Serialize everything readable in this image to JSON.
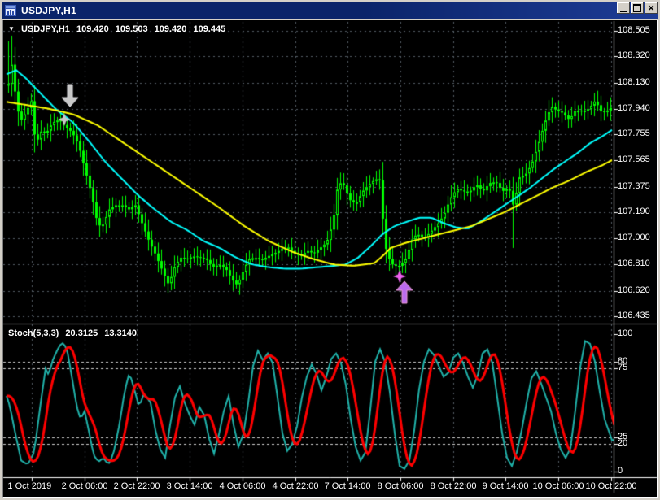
{
  "window": {
    "title": "USDJPY,H1",
    "buttons": {
      "minimize": "minimize",
      "maximize": "maximize",
      "close_glyph": "×"
    }
  },
  "header": {
    "dropdown_glyph": "▼",
    "symbol": "USDJPY,H1",
    "open": "109.420",
    "high": "109.503",
    "low": "109.420",
    "close": "109.445"
  },
  "indicator": {
    "name": "Stoch(5,3,3)",
    "main_value": "20.3125",
    "signal_value": "13.3140"
  },
  "price_axis_labels": [
    "108.505",
    "108.320",
    "108.130",
    "107.940",
    "107.755",
    "107.565",
    "107.375",
    "107.190",
    "107.000",
    "106.810",
    "106.620",
    "106.435"
  ],
  "stoch_axis_labels": [
    "100",
    "80",
    "75",
    "25",
    "20",
    "0"
  ],
  "time_axis_labels": [
    "1 Oct 2019",
    "2 Oct 06:00",
    "2 Oct 22:00",
    "3 Oct 14:00",
    "4 Oct 06:00",
    "4 Oct 22:00",
    "7 Oct 14:00",
    "8 Oct 06:00",
    "8 Oct 22:00",
    "9 Oct 14:00",
    "10 Oct 06:00",
    "10 Oct 22:00"
  ],
  "colors": {
    "background": "#000000",
    "titlebar": "#0A246A",
    "frame": "#D4D0C8",
    "grid": "#555E66",
    "level_line": "#CFCFCF",
    "axis_text": "#FFFFFF",
    "scale_line": "#FFFFFF",
    "separator": "#9A9A9A",
    "candle": "#00FF00",
    "ma_fast_cyan": "#00FFFF",
    "ma_slow_yellow": "#FFFF00",
    "stoch_main": "#20B2AA",
    "stoch_signal": "#FF0000",
    "marker_silver": "#C8C8C8",
    "marker_violet_star": "#ED5FED",
    "marker_violet_arrow": "#BB6BEE"
  },
  "chart_data": {
    "type": "candlestick",
    "symbol": "USDJPY",
    "timeframe": "H1",
    "price_pane": {
      "ylim": [
        106.405,
        108.552
      ],
      "grid_prices": [
        108.505,
        108.32,
        108.13,
        107.94,
        107.755,
        107.565,
        107.375,
        107.19,
        107.0,
        106.81,
        106.62,
        106.435
      ],
      "close_path": [
        [
          10,
          108.12
        ],
        [
          13,
          108.3
        ],
        [
          16,
          108.18
        ],
        [
          20,
          107.95
        ],
        [
          26,
          107.86
        ],
        [
          32,
          107.92
        ],
        [
          40,
          108.02
        ],
        [
          43,
          107.62
        ],
        [
          48,
          107.78
        ],
        [
          56,
          107.76
        ],
        [
          64,
          107.84
        ],
        [
          72,
          107.86
        ],
        [
          80,
          107.81
        ],
        [
          88,
          107.77
        ],
        [
          96,
          107.68
        ],
        [
          104,
          107.5
        ],
        [
          112,
          107.32
        ],
        [
          120,
          107.09
        ],
        [
          126,
          107.1
        ],
        [
          134,
          107.21
        ],
        [
          142,
          107.24
        ],
        [
          150,
          107.24
        ],
        [
          158,
          107.21
        ],
        [
          166,
          107.24
        ],
        [
          174,
          107.11
        ],
        [
          182,
          106.99
        ],
        [
          190,
          106.89
        ],
        [
          198,
          106.78
        ],
        [
          207,
          106.66
        ],
        [
          213,
          106.78
        ],
        [
          221,
          106.86
        ],
        [
          229,
          106.85
        ],
        [
          237,
          106.87
        ],
        [
          245,
          106.86
        ],
        [
          253,
          106.85
        ],
        [
          261,
          106.79
        ],
        [
          269,
          106.81
        ],
        [
          277,
          106.78
        ],
        [
          285,
          106.7
        ],
        [
          291,
          106.66
        ],
        [
          297,
          106.74
        ],
        [
          305,
          106.85
        ],
        [
          313,
          106.86
        ],
        [
          321,
          106.84
        ],
        [
          329,
          106.87
        ],
        [
          337,
          106.89
        ],
        [
          345,
          106.92
        ],
        [
          353,
          106.94
        ],
        [
          361,
          106.89
        ],
        [
          369,
          106.87
        ],
        [
          377,
          106.91
        ],
        [
          385,
          106.89
        ],
        [
          393,
          106.93
        ],
        [
          401,
          106.97
        ],
        [
          409,
          107.12
        ],
        [
          415,
          107.4
        ],
        [
          421,
          107.4
        ],
        [
          429,
          107.28
        ],
        [
          437,
          107.25
        ],
        [
          445,
          107.34
        ],
        [
          453,
          107.39
        ],
        [
          461,
          107.43
        ],
        [
          467,
          107.42
        ],
        [
          471,
          107.05
        ],
        [
          475,
          106.88
        ],
        [
          483,
          106.8
        ],
        [
          491,
          106.8
        ],
        [
          499,
          106.86
        ],
        [
          507,
          107.01
        ],
        [
          513,
          107.03
        ],
        [
          521,
          107.0
        ],
        [
          529,
          107.05
        ],
        [
          537,
          107.1
        ],
        [
          545,
          107.17
        ],
        [
          553,
          107.29
        ],
        [
          561,
          107.36
        ],
        [
          569,
          107.34
        ],
        [
          577,
          107.34
        ],
        [
          585,
          107.39
        ],
        [
          593,
          107.34
        ],
        [
          601,
          107.4
        ],
        [
          609,
          107.41
        ],
        [
          617,
          107.34
        ],
        [
          625,
          107.37
        ],
        [
          631,
          107.22
        ],
        [
          637,
          107.44
        ],
        [
          645,
          107.46
        ],
        [
          653,
          107.54
        ],
        [
          661,
          107.68
        ],
        [
          669,
          107.84
        ],
        [
          677,
          107.96
        ],
        [
          683,
          107.93
        ],
        [
          691,
          107.91
        ],
        [
          699,
          107.86
        ],
        [
          707,
          107.93
        ],
        [
          715,
          107.92
        ],
        [
          723,
          107.94
        ],
        [
          731,
          108.0
        ],
        [
          739,
          107.91
        ],
        [
          747,
          107.93
        ],
        [
          752,
          107.96
        ]
      ],
      "wick_spikes": {
        "high": [
          [
            9,
            108.43
          ],
          [
            13,
            108.47
          ]
        ],
        "low": [
          [
            207,
            106.64
          ],
          [
            291,
            106.65
          ],
          [
            363,
            106.84
          ],
          [
            631,
            106.93
          ]
        ]
      },
      "ma_cyan": [
        [
          8,
          108.19
        ],
        [
          20,
          108.22
        ],
        [
          32,
          108.16
        ],
        [
          50,
          108.05
        ],
        [
          70,
          107.93
        ],
        [
          90,
          107.84
        ],
        [
          110,
          107.7
        ],
        [
          130,
          107.55
        ],
        [
          150,
          107.43
        ],
        [
          170,
          107.31
        ],
        [
          190,
          107.21
        ],
        [
          210,
          107.12
        ],
        [
          230,
          107.06
        ],
        [
          250,
          106.98
        ],
        [
          270,
          106.93
        ],
        [
          290,
          106.86
        ],
        [
          310,
          106.81
        ],
        [
          330,
          106.79
        ],
        [
          350,
          106.78
        ],
        [
          370,
          106.78
        ],
        [
          390,
          106.79
        ],
        [
          410,
          106.8
        ],
        [
          425,
          106.81
        ],
        [
          440,
          106.86
        ],
        [
          455,
          106.94
        ],
        [
          470,
          107.03
        ],
        [
          485,
          107.09
        ],
        [
          500,
          107.12
        ],
        [
          515,
          107.15
        ],
        [
          530,
          107.15
        ],
        [
          545,
          107.11
        ],
        [
          560,
          107.08
        ],
        [
          575,
          107.07
        ],
        [
          590,
          107.12
        ],
        [
          605,
          107.18
        ],
        [
          620,
          107.24
        ],
        [
          635,
          107.3
        ],
        [
          650,
          107.36
        ],
        [
          665,
          107.43
        ],
        [
          680,
          107.5
        ],
        [
          695,
          107.56
        ],
        [
          710,
          107.62
        ],
        [
          725,
          107.69
        ],
        [
          740,
          107.74
        ],
        [
          753,
          107.79
        ]
      ],
      "ma_yellow": [
        [
          8,
          107.99
        ],
        [
          30,
          107.97
        ],
        [
          60,
          107.94
        ],
        [
          90,
          107.9
        ],
        [
          120,
          107.82
        ],
        [
          150,
          107.7
        ],
        [
          180,
          107.58
        ],
        [
          210,
          107.46
        ],
        [
          240,
          107.34
        ],
        [
          270,
          107.22
        ],
        [
          300,
          107.09
        ],
        [
          330,
          106.98
        ],
        [
          360,
          106.9
        ],
        [
          385,
          106.85
        ],
        [
          410,
          106.81
        ],
        [
          435,
          106.8
        ],
        [
          460,
          106.82
        ],
        [
          470,
          106.87
        ],
        [
          480,
          106.93
        ],
        [
          500,
          106.97
        ],
        [
          520,
          107.0
        ],
        [
          540,
          107.03
        ],
        [
          560,
          107.06
        ],
        [
          580,
          107.09
        ],
        [
          600,
          107.14
        ],
        [
          620,
          107.19
        ],
        [
          640,
          107.25
        ],
        [
          660,
          107.31
        ],
        [
          680,
          107.37
        ],
        [
          700,
          107.42
        ],
        [
          720,
          107.48
        ],
        [
          740,
          107.53
        ],
        [
          753,
          107.57
        ]
      ],
      "markers": [
        {
          "shape": "arrow-down",
          "x": 86,
          "price": 107.956,
          "color": "silver"
        },
        {
          "shape": "star4",
          "x": 79,
          "price": 107.862,
          "color": "silver"
        },
        {
          "shape": "star4",
          "x": 491,
          "price": 106.724,
          "color": "violet-star"
        },
        {
          "shape": "arrow-up",
          "x": 497,
          "price": 106.688,
          "color": "violet-arrow"
        }
      ]
    },
    "stoch_pane": {
      "ylim": [
        0,
        100
      ],
      "levels": [
        80,
        75,
        25,
        20
      ],
      "scale_marks": [
        100,
        80,
        75,
        25,
        20,
        0
      ],
      "signal_smoothing": 5,
      "k_path": [
        [
          8,
          55
        ],
        [
          12,
          48
        ],
        [
          18,
          30
        ],
        [
          26,
          8
        ],
        [
          34,
          5
        ],
        [
          42,
          14
        ],
        [
          50,
          50
        ],
        [
          56,
          75
        ],
        [
          60,
          70
        ],
        [
          64,
          80
        ],
        [
          70,
          88
        ],
        [
          76,
          94
        ],
        [
          82,
          90
        ],
        [
          88,
          70
        ],
        [
          94,
          48
        ],
        [
          99,
          38
        ],
        [
          104,
          44
        ],
        [
          109,
          30
        ],
        [
          115,
          12
        ],
        [
          121,
          7
        ],
        [
          127,
          10
        ],
        [
          133,
          5
        ],
        [
          139,
          12
        ],
        [
          147,
          35
        ],
        [
          153,
          58
        ],
        [
          159,
          72
        ],
        [
          165,
          60
        ],
        [
          171,
          47
        ],
        [
          177,
          57
        ],
        [
          185,
          50
        ],
        [
          191,
          30
        ],
        [
          197,
          16
        ],
        [
          203,
          10
        ],
        [
          209,
          34
        ],
        [
          215,
          54
        ],
        [
          221,
          62
        ],
        [
          227,
          50
        ],
        [
          233,
          41
        ],
        [
          239,
          34
        ],
        [
          245,
          47
        ],
        [
          251,
          41
        ],
        [
          257,
          24
        ],
        [
          263,
          13
        ],
        [
          269,
          27
        ],
        [
          275,
          44
        ],
        [
          281,
          55
        ],
        [
          287,
          34
        ],
        [
          293,
          18
        ],
        [
          299,
          27
        ],
        [
          305,
          50
        ],
        [
          311,
          77
        ],
        [
          317,
          88
        ],
        [
          323,
          81
        ],
        [
          329,
          86
        ],
        [
          335,
          79
        ],
        [
          341,
          54
        ],
        [
          347,
          28
        ],
        [
          353,
          15
        ],
        [
          359,
          20
        ],
        [
          365,
          33
        ],
        [
          371,
          54
        ],
        [
          377,
          69
        ],
        [
          383,
          78
        ],
        [
          389,
          71
        ],
        [
          395,
          59
        ],
        [
          401,
          69
        ],
        [
          407,
          82
        ],
        [
          413,
          86
        ],
        [
          419,
          79
        ],
        [
          425,
          63
        ],
        [
          431,
          38
        ],
        [
          437,
          18
        ],
        [
          443,
          8
        ],
        [
          449,
          14
        ],
        [
          455,
          45
        ],
        [
          461,
          80
        ],
        [
          467,
          89
        ],
        [
          473,
          80
        ],
        [
          479,
          58
        ],
        [
          485,
          28
        ],
        [
          491,
          4
        ],
        [
          497,
          2
        ],
        [
          503,
          8
        ],
        [
          509,
          30
        ],
        [
          515,
          60
        ],
        [
          521,
          80
        ],
        [
          527,
          89
        ],
        [
          533,
          85
        ],
        [
          539,
          77
        ],
        [
          545,
          69
        ],
        [
          551,
          72
        ],
        [
          557,
          83
        ],
        [
          563,
          86
        ],
        [
          569,
          79
        ],
        [
          575,
          69
        ],
        [
          581,
          61
        ],
        [
          587,
          70
        ],
        [
          593,
          86
        ],
        [
          599,
          89
        ],
        [
          605,
          79
        ],
        [
          611,
          54
        ],
        [
          617,
          28
        ],
        [
          623,
          10
        ],
        [
          629,
          4
        ],
        [
          635,
          14
        ],
        [
          641,
          30
        ],
        [
          647,
          50
        ],
        [
          653,
          68
        ],
        [
          659,
          73
        ],
        [
          665,
          64
        ],
        [
          671,
          54
        ],
        [
          677,
          44
        ],
        [
          683,
          28
        ],
        [
          689,
          16
        ],
        [
          695,
          10
        ],
        [
          701,
          17
        ],
        [
          707,
          45
        ],
        [
          713,
          76
        ],
        [
          719,
          95
        ],
        [
          725,
          93
        ],
        [
          731,
          80
        ],
        [
          737,
          58
        ],
        [
          743,
          38
        ],
        [
          749,
          28
        ],
        [
          753,
          21
        ],
        [
          756,
          24
        ]
      ]
    }
  }
}
